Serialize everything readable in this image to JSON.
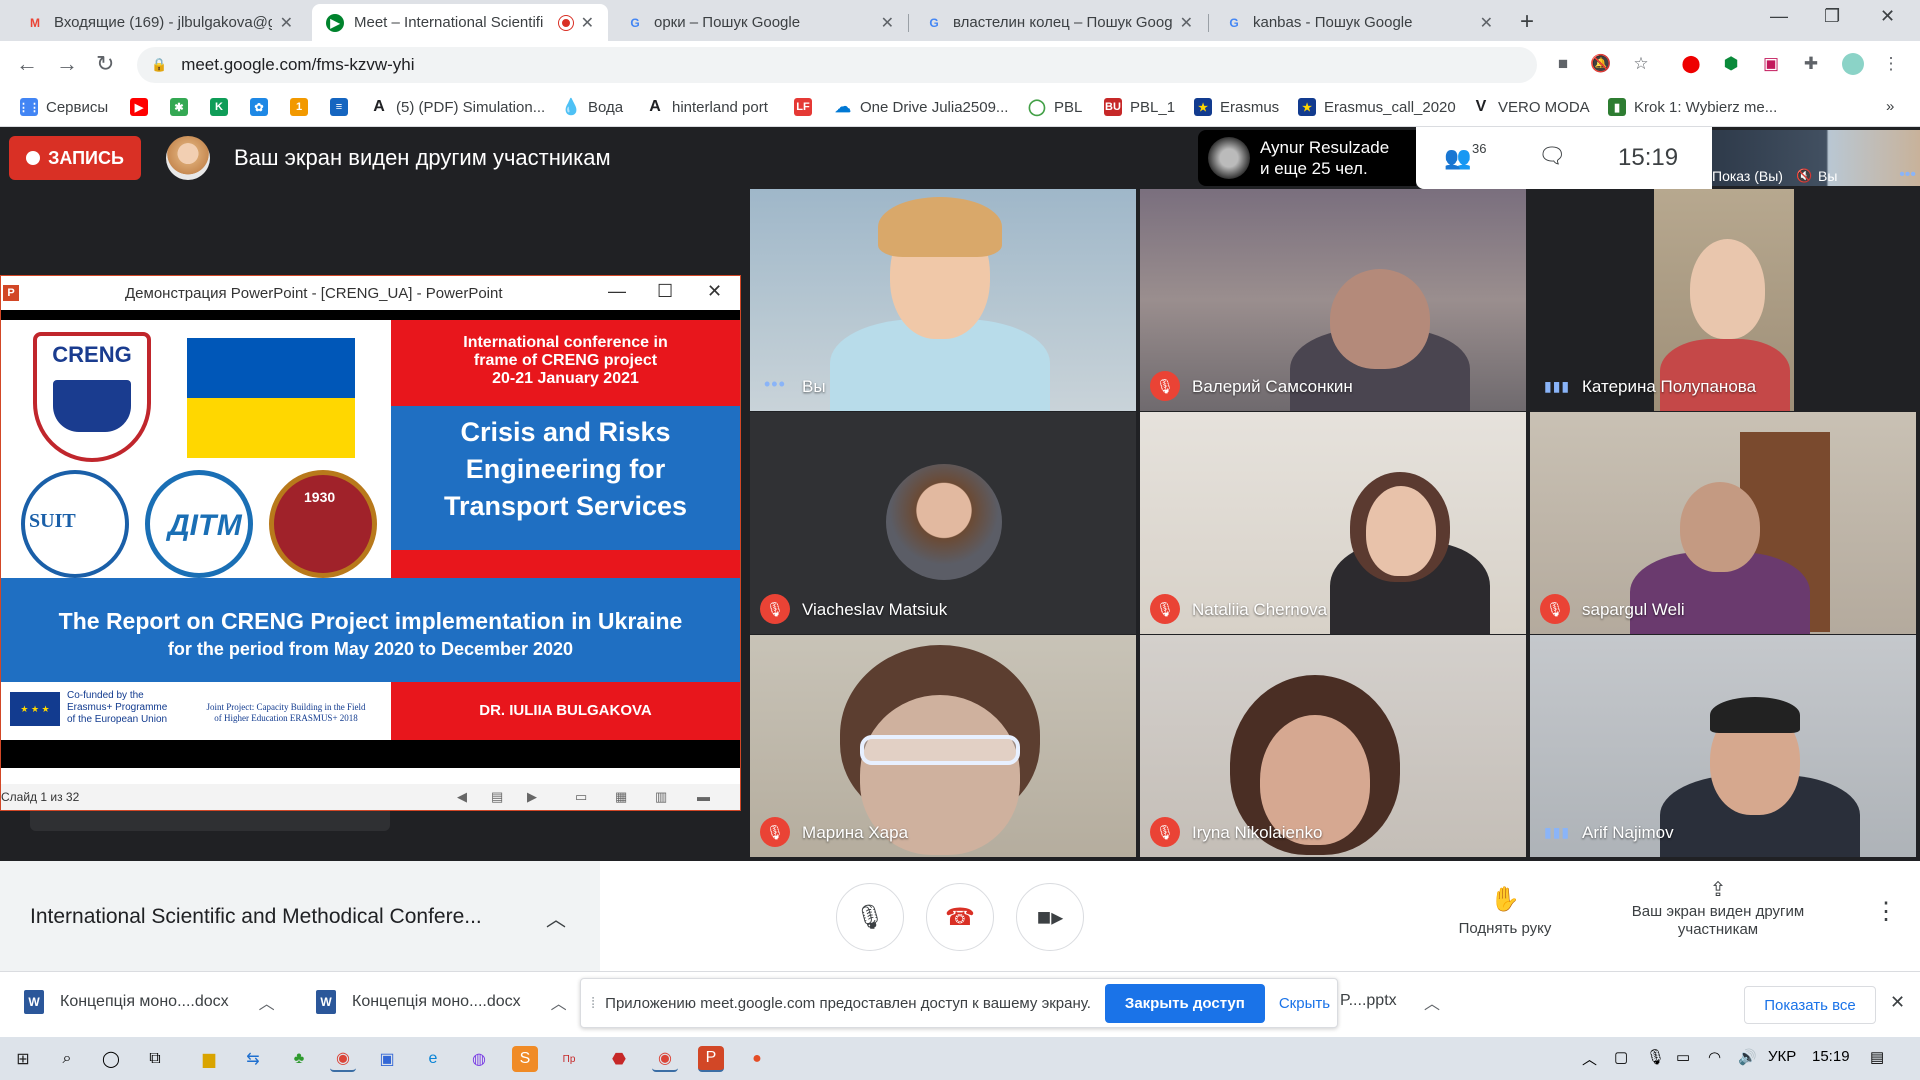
{
  "browser": {
    "tabs": [
      {
        "title": "Входящие (169) - jlbulgakova@g",
        "favicon": "gmail-icon"
      },
      {
        "title": "Meet – International Scientifi",
        "favicon": "meet-icon",
        "active": true,
        "recording": true
      },
      {
        "title": "орки – Пошук Google",
        "favicon": "google-icon"
      },
      {
        "title": "властелин колец – Пошук Goog",
        "favicon": "google-icon"
      },
      {
        "title": "kanbas - Пошук Google",
        "favicon": "google-icon"
      }
    ],
    "url": "meet.google.com/fms-kzvw-yhi",
    "bookmarks": [
      {
        "label": "Сервисы",
        "icon": "apps-icon",
        "color": "#4285f4"
      },
      {
        "label": "",
        "icon": "youtube-icon",
        "color": "#ff0000"
      },
      {
        "label": "",
        "icon": "star-logo-icon",
        "color": "#34a853"
      },
      {
        "label": "",
        "icon": "k-logo-icon",
        "color": "#0f9d58"
      },
      {
        "label": "",
        "icon": "gift-icon",
        "color": "#1e88e5"
      },
      {
        "label": "",
        "icon": "104-icon",
        "color": "#f29900"
      },
      {
        "label": "",
        "icon": "flag-icon",
        "color": "#1565c0"
      },
      {
        "label": "(5) (PDF) Simulation...",
        "icon": "a-logo-icon",
        "color": "#202124"
      },
      {
        "label": "Вода",
        "icon": "drop-icon",
        "color": "#8d6e1a"
      },
      {
        "label": "hinterland port",
        "icon": "a-logo-icon",
        "color": "#202124"
      },
      {
        "label": "",
        "icon": "lf-icon",
        "color": "#e53935"
      },
      {
        "label": "One Drive Julia2509...",
        "icon": "onedrive-icon",
        "color": "#0078d4"
      },
      {
        "label": "PBL",
        "icon": "circle-icon",
        "color": "#43a047"
      },
      {
        "label": "PBL_1",
        "icon": "bu-icon",
        "color": "#c62828"
      },
      {
        "label": "Erasmus",
        "icon": "eu-icon",
        "color": "#123b8f"
      },
      {
        "label": "Erasmus_call_2020",
        "icon": "eu-icon",
        "color": "#123b8f"
      },
      {
        "label": "VERO MODA",
        "icon": "v-icon",
        "color": "#202124"
      },
      {
        "label": "Krok 1: Wybierz me...",
        "icon": "krok-icon",
        "color": "#2e7d32"
      }
    ],
    "more_bookmarks": "»"
  },
  "meet": {
    "record_label": "ЗАПИСЬ",
    "screen_message": "Ваш экран виден другим участникам",
    "active_speaker": "Aynur Resulzade",
    "others_count": "и еще 25 чел.",
    "people_count": "36",
    "time": "15:19",
    "self_preview_label": "Показ (Вы)",
    "self_preview_label2": "Вы",
    "tiles": [
      {
        "name": "Вы",
        "status": "speaking-dots"
      },
      {
        "name": "Валерий Самсонкин",
        "status": "muted"
      },
      {
        "name": "Катерина Полупанова",
        "status": "speaking"
      },
      {
        "name": "Viacheslav Matsiuk",
        "status": "muted"
      },
      {
        "name": "Nataliia Chernova",
        "status": "muted"
      },
      {
        "name": "sapargul Weli",
        "status": "muted"
      },
      {
        "name": "Марина Хара",
        "status": "muted"
      },
      {
        "name": "Iryna Nikolaienko",
        "status": "muted"
      },
      {
        "name": "Arif Najimov",
        "status": "speaking"
      }
    ],
    "meeting_title": "International Scientific and Methodical Confere...",
    "raise_hand": "Поднять руку",
    "presenting_label": "Ваш экран виден другим участникам"
  },
  "ppt": {
    "window_title": "Демонстрация PowerPoint - [CRENG_UA] - PowerPoint",
    "slide_status": "Слайд 1 из 32",
    "slide": {
      "crest_text": "CRENG",
      "seal1": "SUIT",
      "seal2": "ДІТМ",
      "seal3": "1930",
      "conference": [
        "International conference in",
        "frame of CRENG project",
        "20-21 January 2021"
      ],
      "title": [
        "Crisis and Risks",
        "Engineering for",
        "Transport Services"
      ],
      "report_line1": "The Report on CRENG Project implementation in Ukraine",
      "report_line2": "for the period from May 2020 to December 2020",
      "cofunded": [
        "Co-funded by the",
        "Erasmus+ Programme",
        "of the European Union"
      ],
      "joint": [
        "Joint Project: Capacity Building in the Field",
        "of Higher Education ERASMUS+ 2018"
      ],
      "author": "DR. IULIIA BULGAKOVA"
    },
    "colors": {
      "red": "#e8161c",
      "blue": "#1f6fc2"
    }
  },
  "downloads": {
    "items": [
      "Концепція моно....docx",
      "Концепція моно....docx"
    ],
    "share_notice": "Приложению meet.google.com предоставлен доступ к вашему экрану.",
    "stop_share": "Закрыть доступ",
    "hide": "Скрыть",
    "pptx_item": "P....pptx",
    "show_all": "Показать все"
  },
  "taskbar": {
    "lang": "УКР",
    "time": "15:19"
  }
}
